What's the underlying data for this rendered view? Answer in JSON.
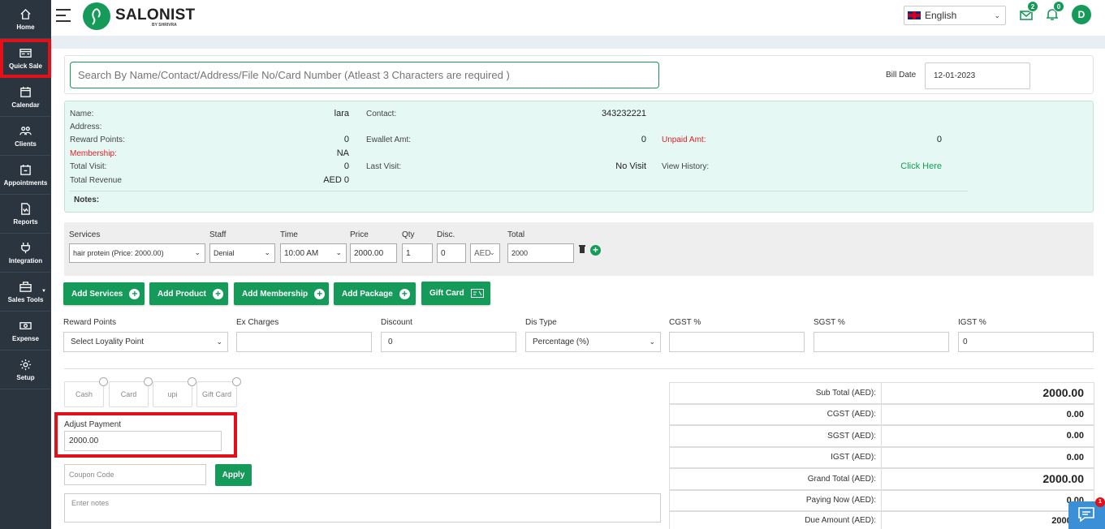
{
  "sidebar": {
    "items": [
      {
        "label": "Home",
        "icon": "home-icon"
      },
      {
        "label": "Quick Sale",
        "icon": "quick-sale-icon"
      },
      {
        "label": "Calendar",
        "icon": "calendar-icon"
      },
      {
        "label": "Clients",
        "icon": "clients-icon"
      },
      {
        "label": "Appointments",
        "icon": "appointments-icon"
      },
      {
        "label": "Reports",
        "icon": "reports-icon"
      },
      {
        "label": "Integration",
        "icon": "integration-icon"
      },
      {
        "label": "Sales Tools",
        "icon": "sales-tools-icon"
      },
      {
        "label": "Expense",
        "icon": "expense-icon"
      },
      {
        "label": "Setup",
        "icon": "setup-icon"
      }
    ]
  },
  "header": {
    "brand": "SALONIST",
    "brand_sub": "BY SHRIVRA",
    "language": "English",
    "messages_count": "2",
    "notifications_count": "0",
    "avatar_initial": "D"
  },
  "search": {
    "placeholder": "Search By Name/Contact/Address/File No/Card Number (Atleast 3 Characters are required )",
    "bill_date_label": "Bill Date",
    "bill_date_value": "12-01-2023"
  },
  "client": {
    "name_label": "Name:",
    "name_value": "lara",
    "contact_label": "Contact:",
    "contact_value": "343232221",
    "address_label": "Address:",
    "reward_label": "Reward Points:",
    "reward_value": "0",
    "ewallet_label": "Ewallet Amt:",
    "ewallet_value": "0",
    "unpaid_label": "Unpaid Amt:",
    "unpaid_value": "0",
    "membership_label": "Membership:",
    "membership_value": "NA",
    "total_visit_label": "Total Visit:",
    "total_visit_value": "0",
    "last_visit_label": "Last Visit:",
    "last_visit_value": "No Visit",
    "view_history_label": "View History:",
    "view_history_link": "Click Here",
    "total_revenue_label": "Total Revenue",
    "total_revenue_value": "AED 0",
    "notes_label": "Notes:"
  },
  "service_line": {
    "headers": {
      "services": "Services",
      "staff": "Staff",
      "time": "Time",
      "price": "Price",
      "qty": "Qty",
      "disc": "Disc.",
      "total": "Total"
    },
    "service": "hair protein (Price: 2000.00)",
    "staff": "Denial",
    "time": "10:00 AM",
    "price": "2000.00",
    "qty": "1",
    "disc": "0",
    "disc_type": "AED",
    "total": "2000"
  },
  "actions": {
    "add_services": "Add Services",
    "add_product": "Add Product",
    "add_membership": "Add Membership",
    "add_package": "Add Package",
    "gift_card": "Gift Card"
  },
  "extras": {
    "reward_points_label": "Reward Points",
    "reward_points_select": "Select Loyality Point",
    "ex_charges_label": "Ex Charges",
    "ex_charges_value": "",
    "discount_label": "Discount",
    "discount_value": "0",
    "dis_type_label": "Dis Type",
    "dis_type_value": "Percentage (%)",
    "cgst_label": "CGST %",
    "cgst_value": "",
    "sgst_label": "SGST %",
    "sgst_value": "",
    "igst_label": "IGST %",
    "igst_value": "0"
  },
  "payment": {
    "methods": [
      "Cash",
      "Card",
      "upi",
      "Gift Card"
    ],
    "adjust_label": "Adjust Payment",
    "adjust_value": "2000.00",
    "coupon_placeholder": "Coupon Code",
    "apply_label": "Apply",
    "notes_placeholder": "Enter notes"
  },
  "totals": [
    {
      "label": "Sub Total (AED):",
      "value": "2000.00"
    },
    {
      "label": "CGST (AED):",
      "value": "0.00"
    },
    {
      "label": "SGST (AED):",
      "value": "0.00"
    },
    {
      "label": "IGST (AED):",
      "value": "0.00"
    },
    {
      "label": "Grand Total (AED):",
      "value": "2000.00"
    },
    {
      "label": "Paying Now (AED):",
      "value": "0.00"
    },
    {
      "label": "Due Amount (AED):",
      "value": "2000.00"
    }
  ],
  "chat": {
    "badge": "1"
  },
  "colors": {
    "brand_green": "#159a5a",
    "sidebar_bg": "#2a3540",
    "highlight_red": "#e3101a",
    "client_box_bg": "#e6f8f3"
  }
}
